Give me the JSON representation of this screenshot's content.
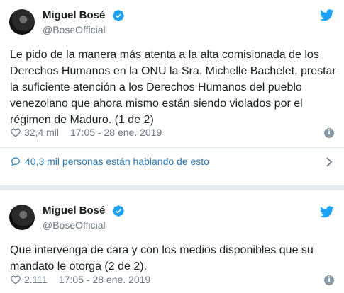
{
  "tweets": [
    {
      "name": "Miguel Bosé",
      "handle": "@BoseOfficial",
      "text": "Le pido de la manera más atenta a la alta comisionada de los Derechos Humanos en la ONU la Sra. Michelle Bachelet, prestar la suficiente atención a los Derechos Humanos del pueblo venezolano que ahora mismo están siendo violados por el régimen de Maduro. (1 de 2)",
      "likes": "32,4 mil",
      "timestamp": "17:05 - 28 ene. 2019",
      "conversation": "40,3 mil personas están hablando de esto"
    },
    {
      "name": "Miguel Bosé",
      "handle": "@BoseOfficial",
      "text": "Que intervenga de cara y con los medios disponibles que su mandato le otorga (2 de 2).",
      "likes": "2.111",
      "timestamp": "17:05 - 28 ene. 2019"
    }
  ],
  "colors": {
    "link": "#2b7bb9",
    "verified": "#1da1f2",
    "twitter_bird": "#1da1f2",
    "muted": "#697882"
  },
  "icons": [
    "verified-badge-icon",
    "twitter-bird-icon",
    "heart-icon",
    "reply-bubble-icon",
    "chevron-right-icon",
    "info-icon"
  ]
}
